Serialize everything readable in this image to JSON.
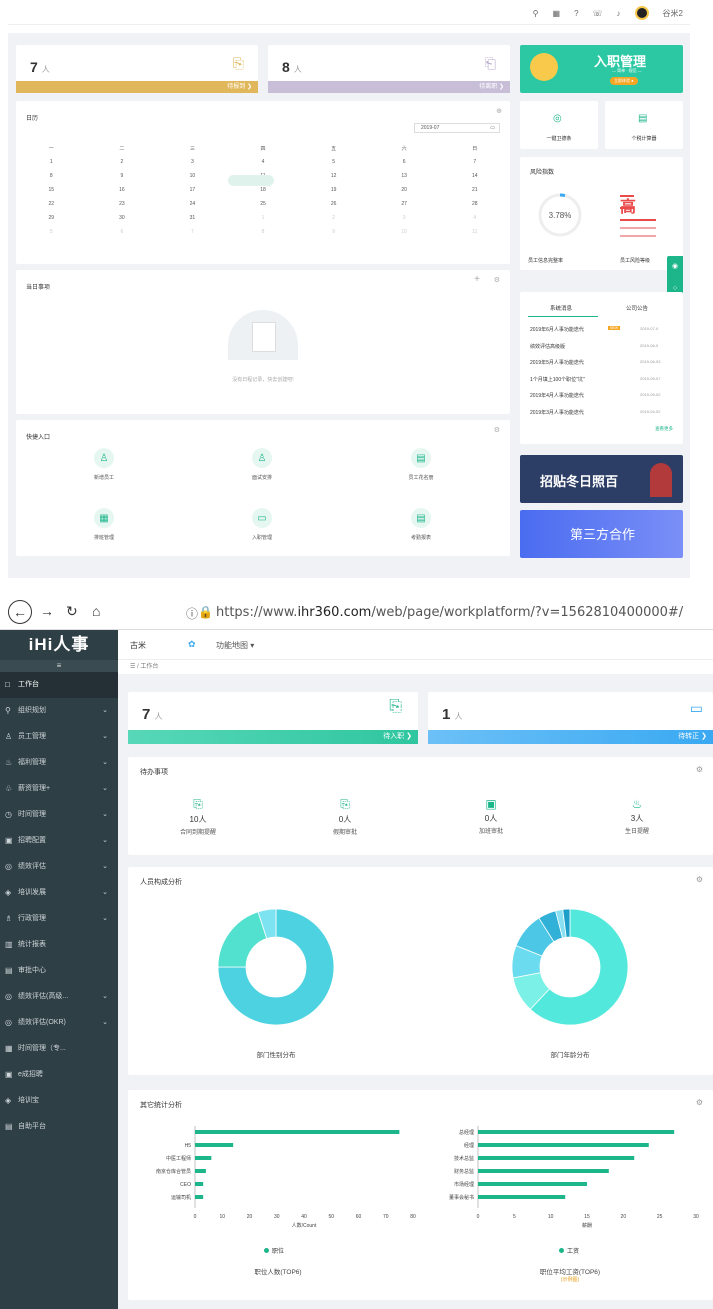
{
  "top": {
    "user_name": "谷米2",
    "kpi": [
      {
        "value": "7",
        "unit": "人",
        "label": "待报到 ❯",
        "color": "#e0b75a"
      },
      {
        "value": "8",
        "unit": "人",
        "label": "待离职 ❯",
        "color": "#c8bed8"
      }
    ],
    "banner": {
      "title": "入职管理",
      "sub": "— 简单 · 规范 —",
      "btn": "立即体验 ●"
    },
    "calendar": {
      "title": "日历",
      "month": "2019-07",
      "weekdays": [
        "一",
        "二",
        "三",
        "四",
        "五",
        "六",
        "日"
      ],
      "rows": [
        [
          "1",
          "2",
          "3",
          "4",
          "5",
          "6",
          "7"
        ],
        [
          "8",
          "9",
          "10",
          "11",
          "12",
          "13",
          "14"
        ],
        [
          "15",
          "16",
          "17",
          "18",
          "19",
          "20",
          "21"
        ],
        [
          "22",
          "23",
          "24",
          "25",
          "26",
          "27",
          "28"
        ],
        [
          "29",
          "30",
          "31",
          "1",
          "2",
          "3",
          "4"
        ],
        [
          "5",
          "6",
          "7",
          "8",
          "9",
          "10",
          "11"
        ]
      ]
    },
    "tools": [
      {
        "label": "一键卫德条"
      },
      {
        "label": "个税计算器"
      }
    ],
    "risk": {
      "title": "风险指数",
      "pct": "3.78%",
      "level": "高",
      "label1": "员工信息完整率",
      "label2": "员工风险等级"
    },
    "today": {
      "title": "当日事项",
      "empty": "没有日程记录，快去创建吧!"
    },
    "news": {
      "tab1": "系统消息",
      "tab2": "公司公告",
      "items": [
        {
          "text": "2019年6月人事功能迭代",
          "tag": "NEW",
          "date": "2019-07-0"
        },
        {
          "text": "绩效评估高级版",
          "tag": "",
          "date": "2019-06-0"
        },
        {
          "text": "2019年5月人事功能迭代",
          "tag": "",
          "date": "2019-06-03"
        },
        {
          "text": "1个月填上100个职位\"坑\"",
          "tag": "",
          "date": "2019-05-07"
        },
        {
          "text": "2019年4月人事功能迭代",
          "tag": "",
          "date": "2019-05-02"
        },
        {
          "text": "2019年3月人事功能迭代",
          "tag": "",
          "date": "2019-04-02"
        }
      ],
      "more": "查看更多"
    },
    "quick": {
      "title": "快捷入口",
      "items": [
        {
          "label": "新增员工"
        },
        {
          "label": "面试安排"
        },
        {
          "label": "员工花名册"
        },
        {
          "label": "排班管理"
        },
        {
          "label": "入职管理"
        },
        {
          "label": "考勤报表"
        }
      ]
    },
    "promo": {
      "text1": "招贴冬日照百",
      "text2": "第三方合作"
    }
  },
  "browser": {
    "url_prefix": "https://www.",
    "url_domain": "ihr360.com",
    "url_rest": "/web/page/workplatform/?v=1562810400000#/"
  },
  "sidebar": {
    "logo": "iHi人事",
    "toggle": "≡",
    "items": [
      {
        "label": "工作台",
        "active": true,
        "chev": false
      },
      {
        "label": "组织规划",
        "chev": true
      },
      {
        "label": "员工管理",
        "chev": true
      },
      {
        "label": "福利管理",
        "chev": true
      },
      {
        "label": "薪资管理+",
        "chev": true
      },
      {
        "label": "时间管理",
        "chev": true
      },
      {
        "label": "招聘配置",
        "chev": true
      },
      {
        "label": "绩效评估",
        "chev": true
      },
      {
        "label": "培训发展",
        "chev": true
      },
      {
        "label": "行政管理",
        "chev": true
      },
      {
        "label": "统计报表",
        "chev": false
      },
      {
        "label": "审批中心",
        "chev": false
      },
      {
        "label": "绩效评估(高级...",
        "chev": true
      },
      {
        "label": "绩效评估(OKR)",
        "chev": true
      },
      {
        "label": "时间管理（专...",
        "chev": false
      },
      {
        "label": "e成招聘",
        "chev": false
      },
      {
        "label": "培训宝",
        "chev": false
      },
      {
        "label": "自助平台",
        "chev": false
      }
    ]
  },
  "header": {
    "company": "古米",
    "map": "功能地图 ▾",
    "crumb": "工作台"
  },
  "main_kpi": [
    {
      "value": "7",
      "unit": "人",
      "label": "待入职 ❯",
      "color": "#35d0a8"
    },
    {
      "value": "1",
      "unit": "人",
      "label": "待转正 ❯",
      "color": "#3aa9f2"
    }
  ],
  "pending": {
    "title": "待办事项",
    "items": [
      {
        "value": "10人",
        "label": "合同到期提醒"
      },
      {
        "value": "0人",
        "label": "假期审批"
      },
      {
        "value": "0人",
        "label": "加班审批"
      },
      {
        "value": "3人",
        "label": "生日提醒"
      }
    ]
  },
  "composition": {
    "title": "人员构成分析",
    "label1": "部门性别分布",
    "label2": "部门年龄分布"
  },
  "other": {
    "title": "其它统计分析",
    "legend1": "职位",
    "legend2": "工资",
    "chart1_title": "职位人数(TOP6)",
    "chart2_title": "职位平均工资(TOP6)",
    "chart2_sub": "(示例图)"
  },
  "chart_data": [
    {
      "type": "pie",
      "title": "部门性别分布",
      "values": [
        75,
        20,
        5
      ]
    },
    {
      "type": "pie",
      "title": "部门年龄分布",
      "values": [
        62,
        10,
        9,
        10,
        5,
        2,
        2
      ]
    },
    {
      "type": "bar",
      "title": "职位人数(TOP6)",
      "categories": [
        "",
        "H5",
        "中医工程师",
        "南京仓库合管员",
        "CEO",
        "运输司机"
      ],
      "values": [
        75,
        14,
        6,
        4,
        3,
        3
      ],
      "series": [
        {
          "name": "职位",
          "values": [
            75,
            14,
            6,
            4,
            3,
            3
          ]
        }
      ],
      "xlabel": "人数/Count",
      "xlim": [
        0,
        80
      ],
      "xticks": [
        "0",
        "10",
        "20",
        "30",
        "40",
        "50",
        "60",
        "70",
        "80"
      ]
    },
    {
      "type": "bar",
      "title": "职位平均工资(TOP6)",
      "categories": [
        "总经理",
        "经理",
        "技术总监",
        "财务总监",
        "市场经理",
        "董事会秘书"
      ],
      "values": [
        27,
        23.5,
        21.5,
        18,
        15,
        12
      ],
      "series": [
        {
          "name": "工资",
          "values": [
            27,
            23.5,
            21.5,
            18,
            15,
            12
          ]
        }
      ],
      "xlabel": "薪酬",
      "xlim": [
        0,
        30
      ],
      "xticks": [
        "0",
        "5",
        "10",
        "15",
        "20",
        "25",
        "30"
      ]
    }
  ]
}
